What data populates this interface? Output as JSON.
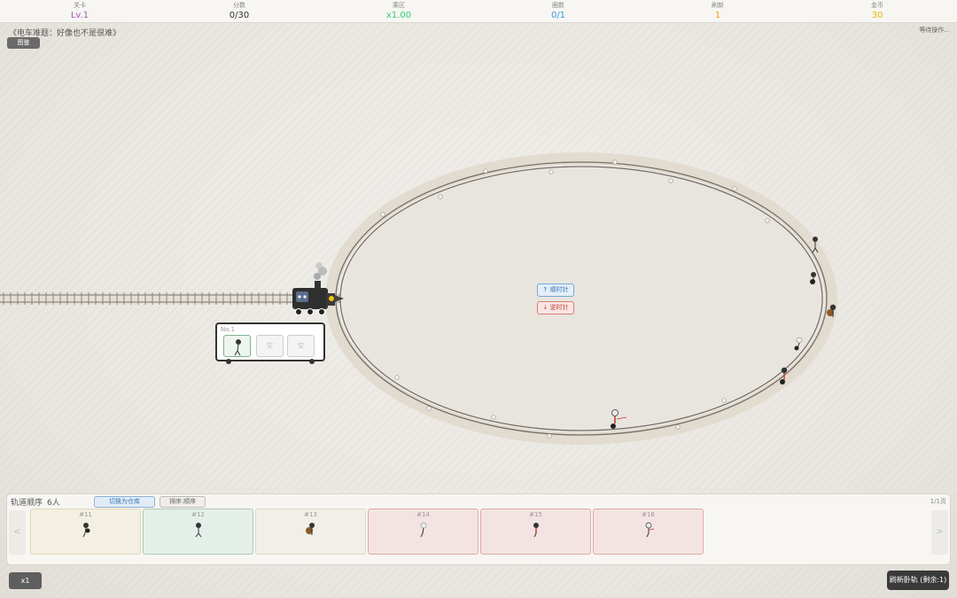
{
  "hud": {
    "level_label": "关卡",
    "level_value": "Lv.1",
    "score_label": "分数",
    "score_value": "0/30",
    "multiplier_label": "乘区",
    "multiplier_value": "x1.00",
    "rounds_label": "圈数",
    "rounds_value": "0/1",
    "refresh_label": "刷新",
    "refresh_value": "1",
    "gold_label": "金币",
    "gold_value": "30",
    "colors": {
      "level": "#9b59b6",
      "score": "#333333",
      "multiplier": "#2ecc71",
      "rounds": "#3498db",
      "refresh": "#f39c12",
      "gold": "#f1c40f"
    }
  },
  "level_title": "《电车难题：好像也不是很难》",
  "atlas_button": "图鉴",
  "status_text": "等待操作...",
  "direction": {
    "clockwise": "↑ 顺时针",
    "counterclockwise": "↓ 逆时针"
  },
  "carriage": {
    "number": "No.1",
    "seat_empty_mark": "空"
  },
  "panel": {
    "title": "轨道顺序",
    "count": "6人",
    "switch_button": "切换为仓库",
    "sort_button": "排序:顺序",
    "page": "1/1页",
    "prev": "<",
    "next": ">",
    "cards": [
      {
        "num": "#11",
        "color": "yellow"
      },
      {
        "num": "#12",
        "color": "green"
      },
      {
        "num": "#13",
        "color": "cream"
      },
      {
        "num": "#14",
        "color": "red"
      },
      {
        "num": "#15",
        "color": "red"
      },
      {
        "num": "#16",
        "color": "red"
      }
    ]
  },
  "speed_button": "x1",
  "refresh_button": "刷新卧轨 (剩余:1)"
}
